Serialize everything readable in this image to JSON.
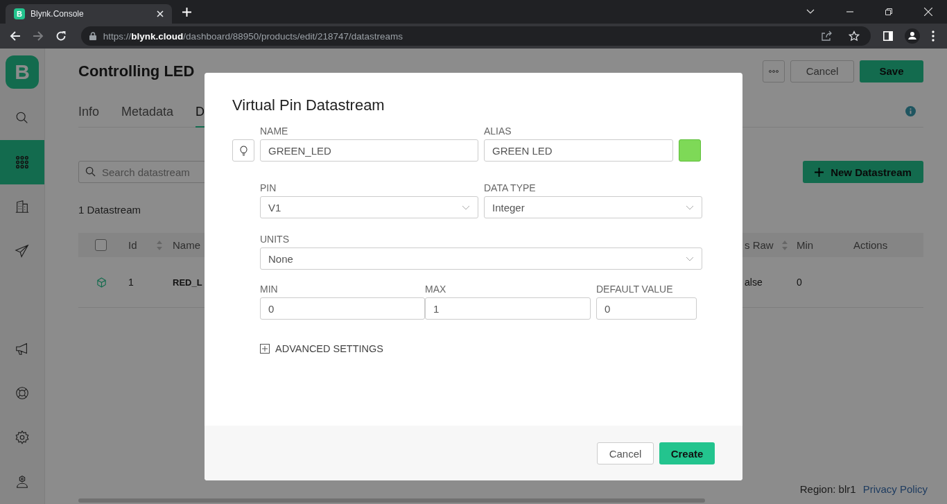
{
  "browser": {
    "favicon": "B",
    "tab_title": "Blynk.Console",
    "url": "https://**blynk.cloud**/dashboard/88950/products/edit/218747/datastreams",
    "forward_disabled": true
  },
  "sidebar": {
    "logo": "B",
    "top_items": [
      {
        "kind": "search",
        "selected": false
      },
      {
        "kind": "grid",
        "selected": true
      },
      {
        "kind": "building",
        "selected": false
      },
      {
        "kind": "send",
        "selected": false
      }
    ],
    "bottom_items": [
      {
        "kind": "megaphone",
        "selected": false
      },
      {
        "kind": "lifebuoy",
        "selected": false
      },
      {
        "kind": "gear",
        "selected": false
      },
      {
        "kind": "user",
        "selected": false
      }
    ]
  },
  "page": {
    "title": "Controlling LED",
    "cancel": "Cancel",
    "save": "Save",
    "tabs": [
      {
        "label": "Info",
        "selected": false
      },
      {
        "label": "Metadata",
        "selected": false
      },
      {
        "label": "D",
        "selected": true
      }
    ],
    "search": {
      "placeholder": "Search datastream"
    },
    "new_button": "New Datastream",
    "count": "1 Datastream",
    "table": {
      "select_all_checked": false,
      "columns": [
        {
          "label": "Id",
          "sortable": true
        },
        {
          "label": "Name",
          "sortable": false
        },
        {
          "label": "s Raw",
          "sortable": true
        },
        {
          "label": "Min",
          "sortable": false
        },
        {
          "label": "Actions",
          "sortable": false
        }
      ],
      "rows": [
        {
          "cells": [
            "1",
            "RED_L",
            "alse",
            "0"
          ]
        }
      ]
    }
  },
  "footer": {
    "region": "Region: blr1",
    "link": "Privacy Policy"
  },
  "dialog": {
    "title": "Virtual Pin Datastream",
    "name": {
      "label": "NAME",
      "value": "GREEN_LED"
    },
    "alias": {
      "label": "ALIAS",
      "value": "GREEN LED"
    },
    "color": "#7ed957",
    "pin": {
      "label": "PIN",
      "value": "V1"
    },
    "data_type": {
      "label": "DATA TYPE",
      "value": "Integer"
    },
    "units": {
      "label": "UNITS",
      "value": "None"
    },
    "min": {
      "label": "MIN",
      "value": "0"
    },
    "max": {
      "label": "MAX",
      "value": "1"
    },
    "default": {
      "label": "DEFAULT VALUE",
      "value": "0"
    },
    "advanced": "ADVANCED SETTINGS",
    "cancel": "Cancel",
    "create": "Create"
  }
}
